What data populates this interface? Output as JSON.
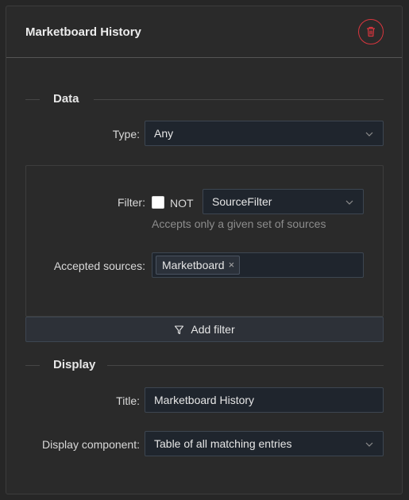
{
  "panel": {
    "title": "Marketboard History",
    "delete_icon": "trash-icon"
  },
  "data_section": {
    "heading": "Data",
    "type_label": "Type",
    "type_value": "Any"
  },
  "filter": {
    "label": "Filter",
    "not_label": "NOT",
    "not_checked": false,
    "filter_type": "SourceFilter",
    "help": "Accepts only a given set of sources",
    "accepted_label": "Accepted sources",
    "accepted_tags": [
      "Marketboard"
    ]
  },
  "add_filter": {
    "label": "Add filter",
    "icon": "filter-icon"
  },
  "display_section": {
    "heading": "Display",
    "title_label": "Title",
    "title_value": "Marketboard History",
    "component_label": "Display component",
    "component_value": "Table of all matching entries"
  },
  "colors": {
    "background": "#262626",
    "panel": "#2a2a2a",
    "input_bg": "#1f252d",
    "danger": "#d9363e"
  }
}
